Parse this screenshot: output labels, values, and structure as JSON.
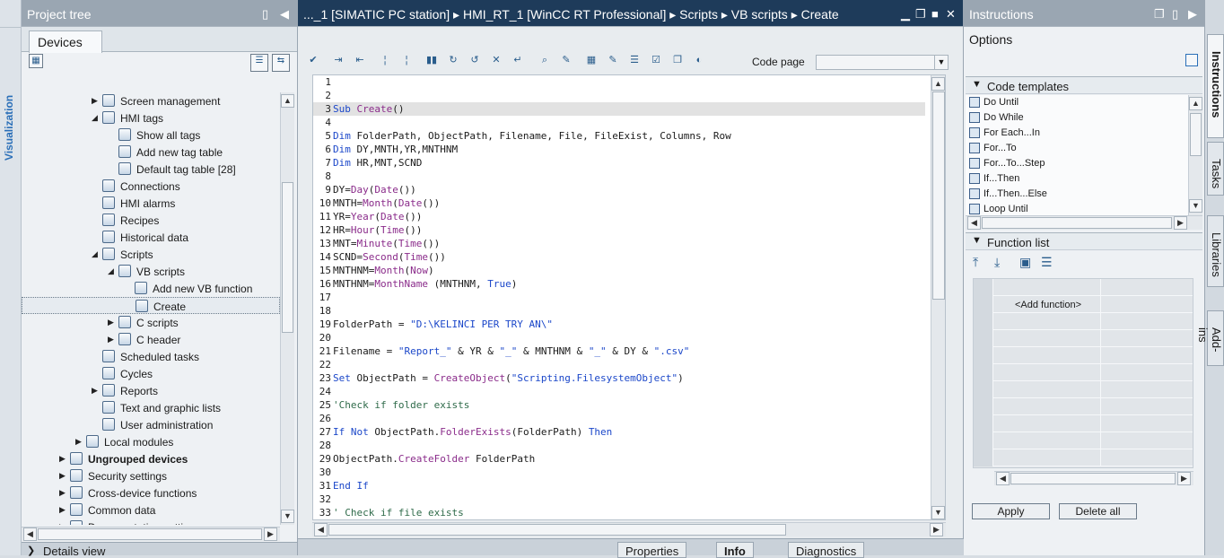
{
  "left_strip": {
    "label": "Visualization"
  },
  "project_tree": {
    "title": "Project tree",
    "tab": "Devices",
    "items": [
      {
        "label": "Screen management",
        "indent": 1,
        "expander": "right",
        "icon": "screen-icon"
      },
      {
        "label": "HMI tags",
        "indent": 1,
        "expander": "down",
        "icon": "tags-icon"
      },
      {
        "label": "Show all tags",
        "indent": 2,
        "expander": "",
        "icon": "tags-list-icon"
      },
      {
        "label": "Add new tag table",
        "indent": 2,
        "expander": "",
        "icon": "add-table-icon"
      },
      {
        "label": "Default tag table [28]",
        "indent": 2,
        "expander": "",
        "icon": "table-icon"
      },
      {
        "label": "Connections",
        "indent": 1,
        "expander": "",
        "icon": "connections-icon"
      },
      {
        "label": "HMI alarms",
        "indent": 1,
        "expander": "",
        "icon": "alarm-icon"
      },
      {
        "label": "Recipes",
        "indent": 1,
        "expander": "",
        "icon": "recipe-icon"
      },
      {
        "label": "Historical data",
        "indent": 1,
        "expander": "",
        "icon": "historical-icon"
      },
      {
        "label": "Scripts",
        "indent": 1,
        "expander": "down",
        "icon": "scripts-icon"
      },
      {
        "label": "VB scripts",
        "indent": 2,
        "expander": "down",
        "icon": "vb-folder-icon"
      },
      {
        "label": "Add new VB function",
        "indent": 3,
        "expander": "",
        "icon": "add-vb-icon"
      },
      {
        "label": "Create",
        "indent": 3,
        "expander": "",
        "icon": "vb-script-icon",
        "selected": true
      },
      {
        "label": "C scripts",
        "indent": 2,
        "expander": "right",
        "icon": "c-folder-icon"
      },
      {
        "label": "C header",
        "indent": 2,
        "expander": "right",
        "icon": "c-header-icon"
      },
      {
        "label": "Scheduled tasks",
        "indent": 1,
        "expander": "",
        "icon": "scheduled-icon"
      },
      {
        "label": "Cycles",
        "indent": 1,
        "expander": "",
        "icon": "cycle-icon"
      },
      {
        "label": "Reports",
        "indent": 1,
        "expander": "right",
        "icon": "reports-icon"
      },
      {
        "label": "Text and graphic lists",
        "indent": 1,
        "expander": "",
        "icon": "lists-icon"
      },
      {
        "label": "User administration",
        "indent": 1,
        "expander": "",
        "icon": "users-icon"
      },
      {
        "label": "Local modules",
        "indent": 0,
        "expander": "right",
        "icon": "module-icon"
      },
      {
        "label": "Ungrouped devices",
        "indent": -1,
        "expander": "right",
        "icon": "devices-icon",
        "bold": true
      },
      {
        "label": "Security settings",
        "indent": -1,
        "expander": "right",
        "icon": "security-icon"
      },
      {
        "label": "Cross-device functions",
        "indent": -1,
        "expander": "right",
        "icon": "cross-device-icon"
      },
      {
        "label": "Common data",
        "indent": -1,
        "expander": "right",
        "icon": "common-data-icon"
      },
      {
        "label": "Documentation settings",
        "indent": -1,
        "expander": "right",
        "icon": "doc-settings-icon"
      }
    ],
    "details_view": "Details view"
  },
  "editor": {
    "breadcrumb": [
      "..._1 [SIMATIC PC station]",
      "HMI_RT_1 [WinCC RT Professional]",
      "Scripts",
      "VB scripts",
      "Create"
    ],
    "code_page_label": "Code page",
    "code_page_value": "",
    "lines": [
      {
        "n": "1",
        "html": ""
      },
      {
        "n": "2",
        "html": ""
      },
      {
        "n": "3",
        "html": "<span class='kw'>Sub</span> <span class='fn'>Create</span>()",
        "hl": true
      },
      {
        "n": "4",
        "html": ""
      },
      {
        "n": "5",
        "html": "<span class='kw'>Dim</span> FolderPath, ObjectPath, Filename, File, FileExist, Columns, Row"
      },
      {
        "n": "6",
        "html": "<span class='kw'>Dim</span> DY,MNTH,YR,MNTHNM"
      },
      {
        "n": "7",
        "html": "<span class='kw'>Dim</span> HR,MNT,SCND"
      },
      {
        "n": "8",
        "html": ""
      },
      {
        "n": "9",
        "html": "DY=<span class='fn'>Day</span>(<span class='fn'>Date</span>())"
      },
      {
        "n": "10",
        "html": "MNTH=<span class='fn'>Month</span>(<span class='fn'>Date</span>())"
      },
      {
        "n": "11",
        "html": "YR=<span class='fn'>Year</span>(<span class='fn'>Date</span>())"
      },
      {
        "n": "12",
        "html": "HR=<span class='fn'>Hour</span>(<span class='fn'>Time</span>())"
      },
      {
        "n": "13",
        "html": "MNT=<span class='fn'>Minute</span>(<span class='fn'>Time</span>())"
      },
      {
        "n": "14",
        "html": "SCND=<span class='fn'>Second</span>(<span class='fn'>Time</span>())"
      },
      {
        "n": "15",
        "html": "MNTHNM=<span class='fn'>Month</span>(<span class='fn'>Now</span>)"
      },
      {
        "n": "16",
        "html": "MNTHNM=<span class='fn'>MonthName</span> (MNTHNM, <span class='kw'>True</span>)"
      },
      {
        "n": "17",
        "html": ""
      },
      {
        "n": "18",
        "html": ""
      },
      {
        "n": "19",
        "html": "FolderPath = <span class='str'>\"D:\\KELINCI PER TRY AN\\\"</span>"
      },
      {
        "n": "20",
        "html": ""
      },
      {
        "n": "21",
        "html": "Filename = <span class='str'>\"Report_\"</span> &amp; YR &amp; <span class='str'>\"_\"</span> &amp; MNTHNM &amp; <span class='str'>\"_\"</span> &amp; DY &amp; <span class='str'>\".csv\"</span>"
      },
      {
        "n": "22",
        "html": ""
      },
      {
        "n": "23",
        "html": "<span class='kw'>Set</span> ObjectPath = <span class='fn'>CreateObject</span>(<span class='str'>\"Scripting.FilesystemObject\"</span>)"
      },
      {
        "n": "24",
        "html": ""
      },
      {
        "n": "25",
        "html": "<span class='cmt'>'Check if folder exists</span>"
      },
      {
        "n": "26",
        "html": ""
      },
      {
        "n": "27",
        "html": "<span class='kw'>If Not</span> ObjectPath.<span class='mem'>FolderExists</span>(FolderPath) <span class='kw'>Then</span>"
      },
      {
        "n": "28",
        "html": ""
      },
      {
        "n": "29",
        "html": "ObjectPath.<span class='mem'>CreateFolder</span> FolderPath"
      },
      {
        "n": "30",
        "html": ""
      },
      {
        "n": "31",
        "html": "<span class='kw'>End If</span>"
      },
      {
        "n": "32",
        "html": ""
      },
      {
        "n": "33",
        "html": "<span class='cmt'>' Check if file exists</span>"
      }
    ],
    "bottom_tabs": {
      "properties": "Properties",
      "info": "Info",
      "diagnostics": "Diagnostics"
    }
  },
  "instructions": {
    "title": "Instructions",
    "options": "Options",
    "code_templates_title": "Code templates",
    "templates": [
      "Do Until",
      "Do While",
      "For Each...In",
      "For...To",
      "For...To...Step",
      "If...Then",
      "If...Then...Else",
      "Loop Until"
    ],
    "function_list_title": "Function list",
    "add_function": "<Add function>",
    "apply": "Apply",
    "delete_all": "Delete all"
  },
  "right_tabs": {
    "instructions": "Instructions",
    "tasks": "Tasks",
    "libraries": "Libraries",
    "addins": "Add-ins"
  }
}
